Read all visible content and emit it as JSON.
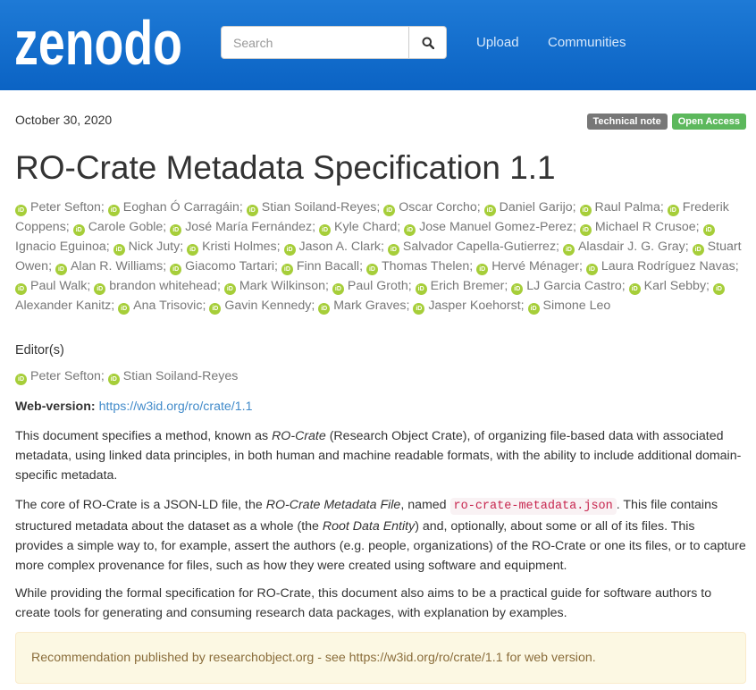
{
  "header": {
    "logo_text": "zenodo",
    "search_placeholder": "Search",
    "nav": [
      "Upload",
      "Communities"
    ]
  },
  "record": {
    "date": "October 30, 2020",
    "badges": [
      "Technical note",
      "Open Access"
    ],
    "title": "RO-Crate Metadata Specification 1.1",
    "authors": [
      "Peter Sefton",
      "Eoghan Ó Carragáin",
      "Stian Soiland-Reyes",
      "Oscar Corcho",
      "Daniel Garijo",
      "Raul Palma",
      "Frederik Coppens",
      "Carole Goble",
      "José María Fernández",
      "Kyle Chard",
      "Jose Manuel Gomez-Perez",
      "Michael R Crusoe",
      "Ignacio Eguinoa",
      "Nick Juty",
      "Kristi Holmes",
      "Jason A. Clark",
      "Salvador Capella-Gutierrez",
      "Alasdair J. G. Gray",
      "Stuart Owen",
      "Alan R. Williams",
      "Giacomo Tartari",
      "Finn Bacall",
      "Thomas Thelen",
      "Hervé Ménager",
      "Laura Rodríguez Navas",
      "Paul Walk",
      "brandon whitehead",
      "Mark Wilkinson",
      "Paul Groth",
      "Erich Bremer",
      "LJ Garcia Castro",
      "Karl Sebby",
      "Alexander Kanitz",
      "Ana Trisovic",
      "Gavin Kennedy",
      "Mark Graves",
      "Jasper Koehorst",
      "Simone Leo"
    ],
    "editors_heading": "Editor(s)",
    "editors": [
      "Peter Sefton",
      "Stian Soiland-Reyes"
    ],
    "web_version_label": "Web-version:",
    "web_version_url": "https://w3id.org/ro/crate/1.1",
    "p1": {
      "a": "This document specifies a method, known as ",
      "b": "RO-Crate",
      "c": " (Research Object Crate), of organizing file-based data with associated metadata, using linked data principles, in both human and machine readable formats, with the ability to include additional domain-specific metadata."
    },
    "p2": {
      "a": "The core of RO-Crate is a JSON-LD file, the ",
      "b": "RO-Crate Metadata File",
      "c": ", named ",
      "code": "ro-crate-metadata.json",
      "d": ". This file contains structured metadata about the dataset as a whole (the ",
      "e": "Root Data Entity",
      "f": ") and, optionally, about some or all of its files. This provides a simple way to, for example, assert the authors (e.g. people, organizations) of the RO-Crate or one its files, or to capture more complex provenance for files, such as how they were created using software and equipment."
    },
    "p3": "While providing the formal specification for RO-Crate, this document also aims to be a practical guide for software authors to create tools for generating and consuming research data packages, with explanation by examples.",
    "notice": "Recommendation published by researchobject.org - see https://w3id.org/ro/crate/1.1 for web version."
  },
  "colors": {
    "header": "#0b63c4",
    "orcid": "#a6ce39",
    "open_access": "#5cb85c"
  },
  "icons": {
    "search": "search-icon",
    "orcid": "orcid-icon"
  }
}
